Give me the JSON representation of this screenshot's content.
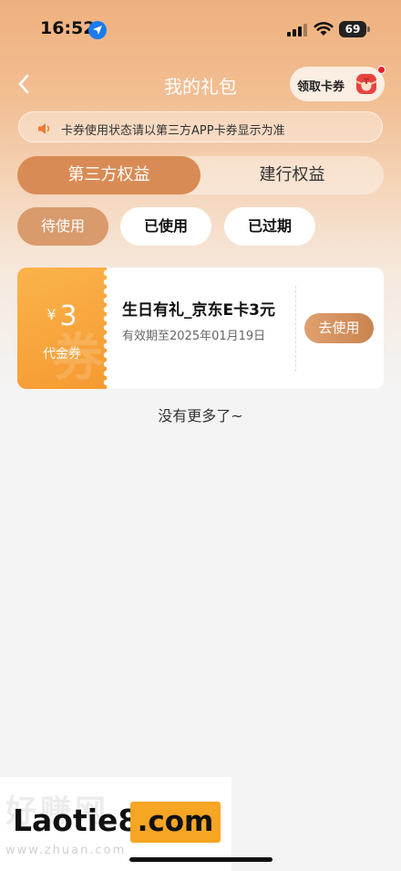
{
  "status_bar": {
    "time": "16:52",
    "battery": "69"
  },
  "nav": {
    "title": "我的礼包",
    "coupon_button_label": "领取卡券",
    "coupon_icon_char": "¥"
  },
  "notice": {
    "text": "卡券使用状态请以第三方APP卡券显示为准"
  },
  "segment_tabs": [
    {
      "label": "第三方权益",
      "active": true
    },
    {
      "label": "建行权益",
      "active": false
    }
  ],
  "filter_pills": [
    {
      "label": "待使用",
      "active": true
    },
    {
      "label": "已使用",
      "active": false
    },
    {
      "label": "已过期",
      "active": false
    }
  ],
  "voucher": {
    "currency": "¥",
    "amount": "3",
    "type_label": "代金券",
    "watermark_char": "券",
    "title": "生日有礼_京东E卡3元",
    "expiry": "有效期至2025年01月19日",
    "action_label": "去使用"
  },
  "list_end_text": "没有更多了~",
  "watermark": {
    "faint_text": "好赚网",
    "main_text": "Laotie8",
    "com_text": ".com",
    "url_text": "www.zhuan.com"
  },
  "colors": {
    "accent": "#d98b55",
    "voucher_orange": "#f69a31",
    "badge_red": "#e8202a"
  }
}
